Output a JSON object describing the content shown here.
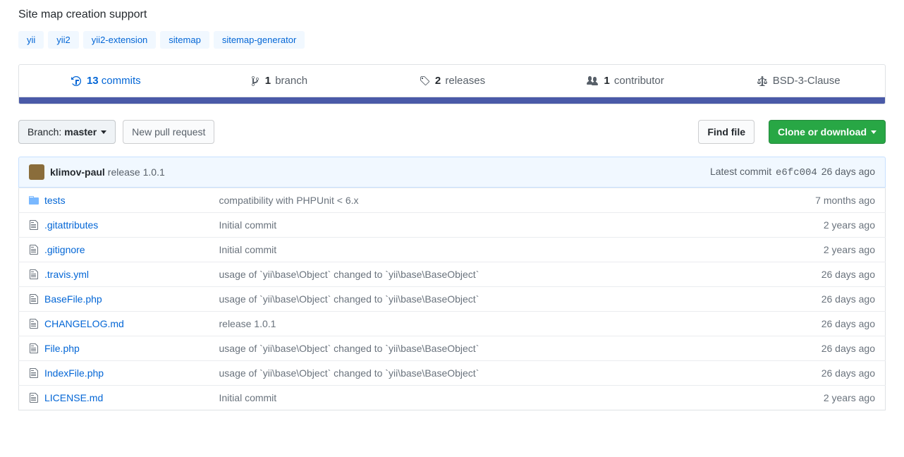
{
  "description": "Site map creation support",
  "topics": [
    "yii",
    "yii2",
    "yii2-extension",
    "sitemap",
    "sitemap-generator"
  ],
  "summary": {
    "commits_count": "13",
    "commits_label": "commits",
    "branches_count": "1",
    "branches_label": "branch",
    "releases_count": "2",
    "releases_label": "releases",
    "contributors_count": "1",
    "contributors_label": "contributor",
    "license_label": "BSD-3-Clause"
  },
  "toolbar": {
    "branch_prefix": "Branch:",
    "branch_name": "master",
    "new_pr": "New pull request",
    "find_file": "Find file",
    "clone": "Clone or download"
  },
  "commit": {
    "author": "klimov-paul",
    "message": "release 1.0.1",
    "latest_prefix": "Latest commit",
    "hash": "e6fc004",
    "age": "26 days ago"
  },
  "files": [
    {
      "type": "dir",
      "name": "tests",
      "msg": "compatibility with PHPUnit < 6.x",
      "age": "7 months ago"
    },
    {
      "type": "file",
      "name": ".gitattributes",
      "msg": "Initial commit",
      "age": "2 years ago"
    },
    {
      "type": "file",
      "name": ".gitignore",
      "msg": "Initial commit",
      "age": "2 years ago"
    },
    {
      "type": "file",
      "name": ".travis.yml",
      "msg": "usage of `yii\\base\\Object` changed to `yii\\base\\BaseObject`",
      "age": "26 days ago"
    },
    {
      "type": "file",
      "name": "BaseFile.php",
      "msg": "usage of `yii\\base\\Object` changed to `yii\\base\\BaseObject`",
      "age": "26 days ago"
    },
    {
      "type": "file",
      "name": "CHANGELOG.md",
      "msg": "release 1.0.1",
      "age": "26 days ago"
    },
    {
      "type": "file",
      "name": "File.php",
      "msg": "usage of `yii\\base\\Object` changed to `yii\\base\\BaseObject`",
      "age": "26 days ago"
    },
    {
      "type": "file",
      "name": "IndexFile.php",
      "msg": "usage of `yii\\base\\Object` changed to `yii\\base\\BaseObject`",
      "age": "26 days ago"
    },
    {
      "type": "file",
      "name": "LICENSE.md",
      "msg": "Initial commit",
      "age": "2 years ago"
    }
  ]
}
